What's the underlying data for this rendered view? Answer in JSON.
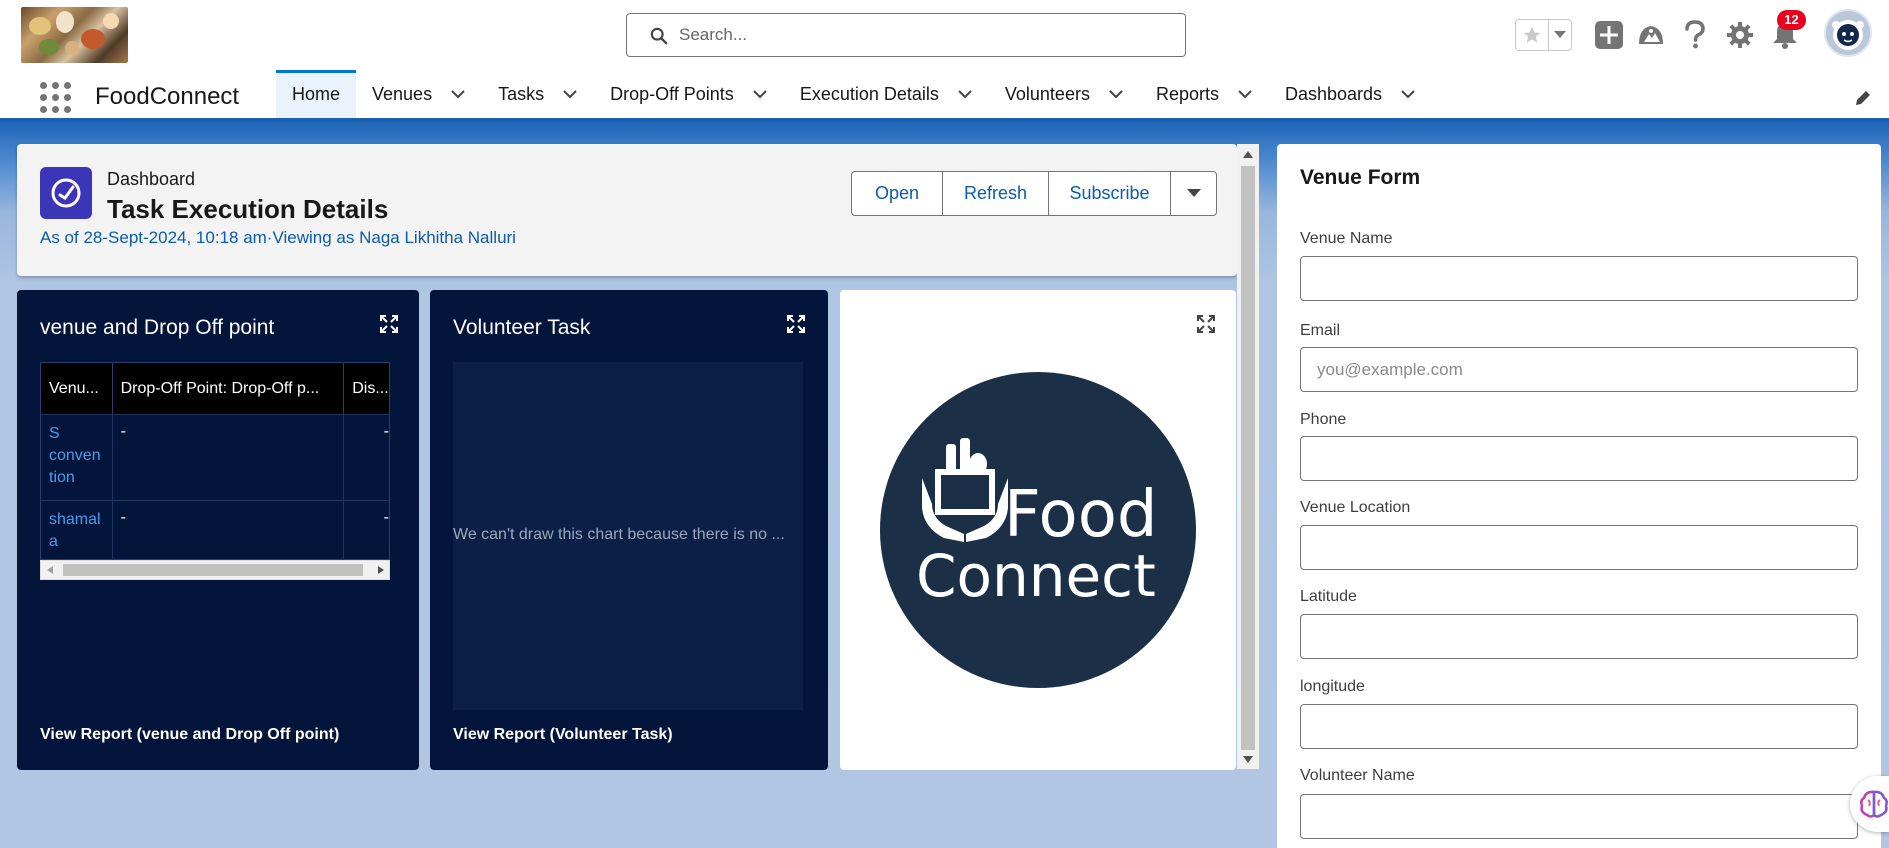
{
  "header": {
    "search": {
      "placeholder": "Search..."
    },
    "notification_count": "12",
    "icons": [
      "favorites-star-icon",
      "add-icon",
      "trailhead-icon",
      "help-icon",
      "setup-gear-icon",
      "bell-icon",
      "user-avatar"
    ]
  },
  "nav": {
    "app_name": "FoodConnect",
    "tabs": [
      {
        "label": "Home",
        "active": true
      },
      {
        "label": "Venues"
      },
      {
        "label": "Tasks"
      },
      {
        "label": "Drop-Off Points"
      },
      {
        "label": "Execution Details"
      },
      {
        "label": "Volunteers"
      },
      {
        "label": "Reports"
      },
      {
        "label": "Dashboards"
      }
    ]
  },
  "dashboard": {
    "type_label": "Dashboard",
    "title": "Task Execution Details",
    "as_of": "As of 28-Sept-2024, 10:18 am·Viewing as Naga Likhitha Nalluri",
    "buttons": {
      "open": "Open",
      "refresh": "Refresh",
      "subscribe": "Subscribe"
    }
  },
  "widgets": {
    "venue_dropoff": {
      "title": "venue and Drop Off point",
      "columns": [
        "Venu...",
        "Drop-Off Point: Drop-Off p...",
        "Dis..."
      ],
      "rows": [
        {
          "venue": "S conven tion",
          "dropoff": "-",
          "dist": "-"
        },
        {
          "venue": "shamal a",
          "dropoff": "-",
          "dist": "-"
        }
      ],
      "view_report": "View Report (venue and Drop Off point)"
    },
    "volunteer_task": {
      "title": "Volunteer Task",
      "empty_message": "We can't draw this chart because there is no ...",
      "view_report": "View Report (Volunteer Task)"
    },
    "logo": {
      "line1": "Food",
      "line2": "Connect"
    }
  },
  "venue_form": {
    "title": "Venue Form",
    "fields": [
      {
        "label": "Venue Name",
        "value": "",
        "placeholder": ""
      },
      {
        "label": "Email",
        "value": "",
        "placeholder": "you@example.com"
      },
      {
        "label": "Phone",
        "value": "",
        "placeholder": ""
      },
      {
        "label": "Venue Location",
        "value": "",
        "placeholder": ""
      },
      {
        "label": "Latitude",
        "value": "",
        "placeholder": ""
      },
      {
        "label": "longitude",
        "value": "",
        "placeholder": ""
      },
      {
        "label": "Volunteer Name",
        "value": "",
        "placeholder": ""
      }
    ]
  },
  "colors": {
    "brand_blue": "#0176d3",
    "nav_underline": "#1b5fb0",
    "widget_bg": "#03153b",
    "link": "#0b5cab",
    "badge": "#ea001e"
  }
}
